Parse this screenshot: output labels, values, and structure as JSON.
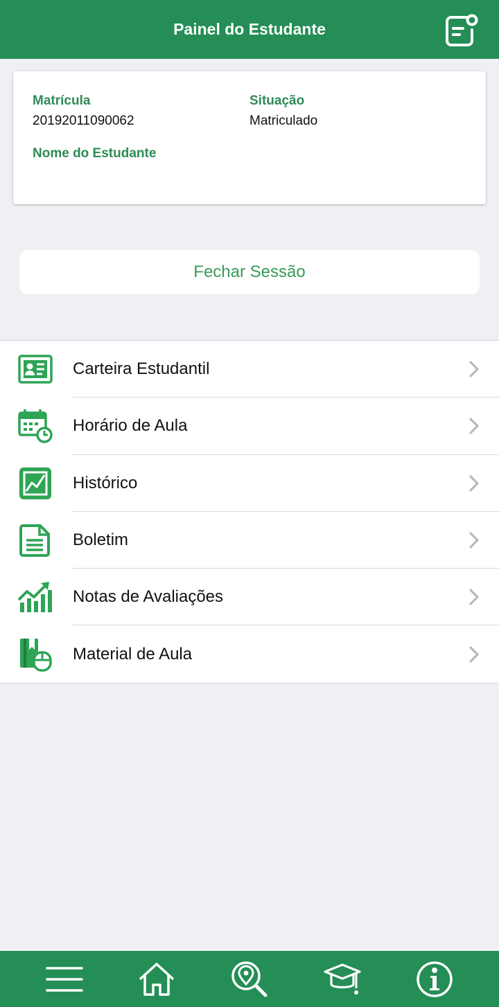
{
  "header": {
    "title": "Painel do Estudante",
    "action_icon": "logout-note-icon"
  },
  "student": {
    "matricula_label": "Matrícula",
    "matricula_value": "20192011090062",
    "situacao_label": "Situação",
    "situacao_value": "Matriculado",
    "nome_label": "Nome do Estudante",
    "nome_value": ""
  },
  "logout_button": "Fechar Sessão",
  "menu": {
    "items": [
      {
        "label": "Carteira Estudantil",
        "icon": "id-card-icon"
      },
      {
        "label": "Horário de Aula",
        "icon": "calendar-clock-icon"
      },
      {
        "label": "Histórico",
        "icon": "chart-frame-icon"
      },
      {
        "label": "Boletim",
        "icon": "document-icon"
      },
      {
        "label": "Notas de Avaliações",
        "icon": "growth-chart-icon"
      },
      {
        "label": "Material de Aula",
        "icon": "book-mouse-icon"
      }
    ]
  },
  "tabbar": {
    "items": [
      {
        "icon": "menu-icon"
      },
      {
        "icon": "home-icon"
      },
      {
        "icon": "location-search-icon"
      },
      {
        "icon": "graduation-cap-icon"
      },
      {
        "icon": "info-icon"
      }
    ]
  },
  "colors": {
    "primary": "#248e56",
    "label_green": "#2f8a55",
    "button_text": "#3a9a57",
    "background": "#efeff4",
    "icon_green": "#2ea455"
  }
}
